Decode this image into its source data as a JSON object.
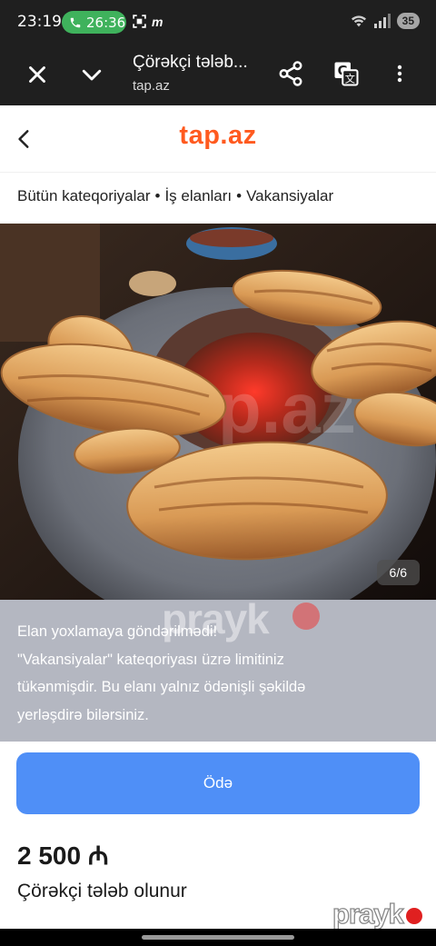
{
  "status_bar": {
    "time": "23:19",
    "call_timer": "26:36",
    "battery": "35",
    "icons": [
      "phone-icon",
      "screenshot-icon",
      "m-icon",
      "wifi-icon",
      "signal-icon"
    ]
  },
  "browser": {
    "title": "Çörəkçi tələb...",
    "url": "tap.az",
    "icons": [
      "close-icon",
      "chevron-down-icon",
      "share-icon",
      "translate-icon",
      "more-vert-icon"
    ]
  },
  "site": {
    "logo": "tap.az",
    "logo_color": "#ff5a1f",
    "back_icon": "chevron-left-icon"
  },
  "breadcrumb": {
    "items": [
      "Bütün kateqoriyalar",
      "İş elanları",
      "Vakansiyalar"
    ],
    "separator": "•"
  },
  "gallery": {
    "counter": "6/6",
    "image_watermark": "tap.az"
  },
  "alert": {
    "line1": "Elan yoxlamaya göndərilmədi!",
    "line2": "\"Vakansiyalar\" kateqoriyası üzrə limitiniz",
    "line3": "tükənmişdir. Bu elanı yalnız ödənişli şəkildə",
    "line4": "yerləşdirə bilərsiniz.",
    "watermark": "prayk",
    "background": "#b4b7c1"
  },
  "pay_button": {
    "label": "Ödə",
    "color": "#4f8ff7"
  },
  "listing": {
    "price": "2 500 ₼",
    "title": "Çörəkçi tələb olunur"
  },
  "watermark": {
    "text": "prayk"
  }
}
